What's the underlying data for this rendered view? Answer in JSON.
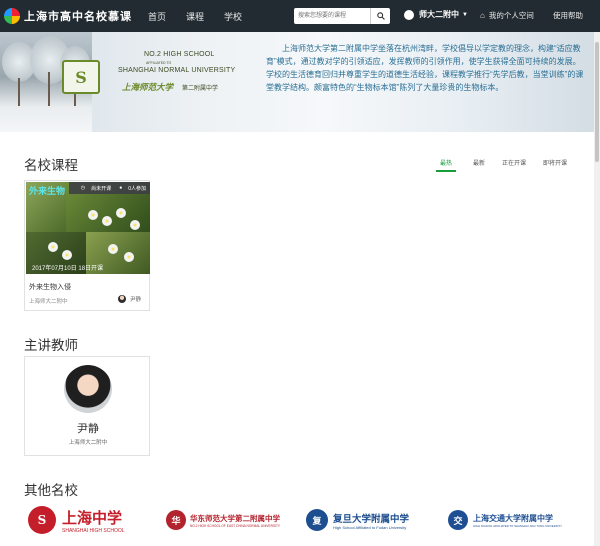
{
  "header": {
    "logo_text": "上海市高中名校慕课",
    "nav": [
      "首页",
      "课程",
      "学校"
    ],
    "search": {
      "placeholder": "搜索您想要的课程"
    },
    "user_name": "师大二附中",
    "my_space": "我的个人空间",
    "help": "使用帮助"
  },
  "banner": {
    "school_en_1": "NO.2 HIGH SCHOOL",
    "school_en_2": "AFFILIATED TO",
    "school_en_3": "SHANGHAI NORMAL UNIVERSITY",
    "school_cn_1": "上海师范大学",
    "school_cn_2": "第二附属中学",
    "intro": "上海师范大学第二附属中学坐落在杭州湾畔，学校倡导以学定教的理念，构建“适应教育”模式，通过教对学的引领适应，发挥教师的引领作用，使学生获得全面可持续的发展。学校的生活德育回归并尊重学生的道德生活经验，课程教学推行“先学后教，当堂训练”的课堂教学结构。颇富特色的“生物标本馆”陈列了大量珍贵的生物标本。"
  },
  "courses": {
    "heading": "名校课程",
    "tabs": [
      "最热",
      "最新",
      "正在开课",
      "即将开课"
    ],
    "active_tab": "最热",
    "items": [
      {
        "thumb_title": "外来生物",
        "status": "尚未开课",
        "enrolled": "0人参加",
        "date": "2017年07月10日 18日开课",
        "title": "外来生物入侵",
        "school": "上海师大二附中",
        "teacher": "尹静"
      }
    ]
  },
  "teachers": {
    "heading": "主讲教师",
    "items": [
      {
        "name": "尹静",
        "school": "上海师大二附中"
      }
    ]
  },
  "schools": {
    "heading": "其他名校",
    "items": [
      {
        "cn": "上海中学",
        "en": "SHANGHAI HIGH SCHOOL",
        "color": "#c41e2a"
      },
      {
        "cn": "华东师范大学第二附属中学",
        "en": "NO.2 HIGH SCHOOL OF EAST CHINA NORMAL UNIVERSITY",
        "color": "#b3232d"
      },
      {
        "cn": "复旦大学附属中学",
        "en": "High School Affiliated to Fudan University",
        "color": "#1d4e8f"
      },
      {
        "cn": "上海交通大学附属中学",
        "en": "HIGH SCHOOL AFFILIATED TO SHANGHAI JIAO TONG UNIVERSITY",
        "color": "#1f4f93"
      }
    ]
  }
}
